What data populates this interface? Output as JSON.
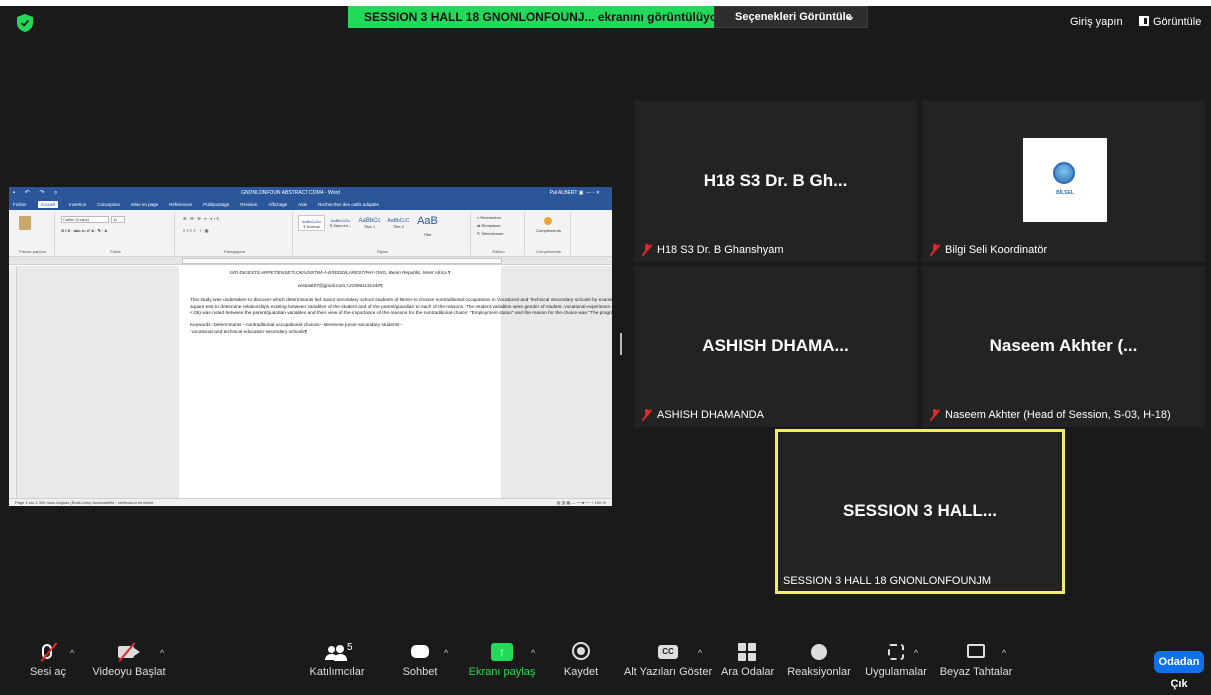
{
  "topbar": {
    "share_banner": "SESSION 3 HALL 18 GNONLONFOUNJ... ekranını görüntülüyorsunuz",
    "options_label": "Seçenekleri Görüntüle",
    "signin_label": "Giriş yapın",
    "view_label": "Görüntüle"
  },
  "shared_doc": {
    "window_title": "GNONLONFOUN ABSTRACT.COM4 - Word",
    "user": "Pal ALBERT",
    "menu": [
      "Fichier",
      "Accueil",
      "Insertion",
      "Conception",
      "Mise en page",
      "Références",
      "Publipostage",
      "Révision",
      "Affichage",
      "Aide",
      "Rechercher des outils adaptés"
    ],
    "ribbon_groups": [
      "Presse-papiers",
      "Police",
      "Paragraphe",
      "Styles",
      "Édition",
      "Compléments"
    ],
    "font_name": "Calibri (Corps)",
    "font_size": "11",
    "styles": [
      "AaBbCcDc",
      "AaBbCcDc",
      "AaBbCc",
      "AaBbCcC",
      "AaB"
    ],
    "style_names": [
      "¶ Normal",
      "¶ Sans int...",
      "Titre 1",
      "Titre 2",
      "Titre"
    ],
    "edit_items": [
      "Rechercher",
      "Remplacer",
      "Sélectionner"
    ],
    "affiliation": "GRI-DIGEST/LARPET/ENSETLOK/UNSTIM-A-EREDD/LAREST/PAY-ONG, Benin Republic, West Africa.¶",
    "email": "vostook07@gmail.com;+229961131340¶",
    "abstract": "This·study·was·undertaken·to·discover·which·determinants·led·Junior·secondary·school·students·of·Benin·to·choose·nontraditional·occupations·in·Vocational·and·Technical·Secondary·schools·by·examining·two·participant·categories:·260·nontraditional·students·enrolled·in·the·26·vocational·and·technical·schools·at·the·rate·of·10·students·per·school,·and·one·of·each·student's·parents.·Two·survey·instruments·were·used·of·which·the·first·15·items·were·questions·directed·to·the·nontraditional·student·or·the·parent/guardian.·The·last·10·items·were·reasons·that·may·have·led·the·student·to·a·nontraditional·choice,·the·importance·of·which·were·determined·by·the·student·and·the·parent/guardian.·Responses·were·subjected·to·a·frequency·distribution·analysis,·and·the·last·10·items·were·subjected·to·the·Chi-square·test·to·determine·relationships·existing·between·variables·of·the·student·and·of·the·parent/guardian·to·each·of·the·reasons.·The·student·variables·were·gender·of·student,·vocational·experience·of·a·student's·sibling/s,·and·participation·in·an·exploratory·program.·The·parent/guardian·variables·were·educational·level,·employment·status,·and·economic·status.·Analyses·of·findings·revealed·that·determinants·such·as·career·opportunity·of·the·program,·interest·in·the·subject,·exploratory·possibilities·and·their·teachers·were·important·to·the·nontraditional·choice.·There·was·only·one·significant·positive·relationship·(p=<.05)·was·noted·between·the·parent/guardian·variables·and·their·view·of·the·importance·of·the·reasons·for·the·nontraditional·choice:·\"Employment·status\"·and·the·reason·for·the·choice·was·\"The·program·seemed·easy.\"·Regardless·of·the·employment·status·of·the·parent,·most·respondents·believed·the·reason·was·not·important·to·the·nontraditional·choice.·Therefore,·exploratory·programs·for·all·the·courses·offered·by·the·VET·secondary·schools·should·be·presented·to·every·new·student·and·that·the·teachers·of·these·exploratory·programs·should·be·chosen·with·great·care.¶",
    "keywords": "Keywords:·Determinants·-·nontraditional·occupational·choices·-·Beninese·junior·secondary·students·-·vocational·and·technical·education·secondary·schools¶",
    "status_left": "Page 1 sur 1    339 mots    Anglais (États-Unis)    Accessibilité : vérification terminée",
    "status_zoom": "100 %"
  },
  "participants": [
    {
      "display": "H18 S3 Dr. B Gh...",
      "name": "H18 S3 Dr. B Ghanshyam",
      "muted": true
    },
    {
      "display": "",
      "name": "Bilgi Seli Koordinatör",
      "muted": true,
      "logo_text": "BİLSEL"
    },
    {
      "display": "ASHISH  DHAMA...",
      "name": "ASHISH DHAMANDA",
      "muted": true
    },
    {
      "display": "Naseem Akhter (...",
      "name": "Naseem Akhter (Head of Session, S-03, H-18)",
      "muted": true
    },
    {
      "display": "SESSION 3 HALL...",
      "name": "SESSION 3 HALL 18 GNONLONFOUNJM",
      "muted": false
    }
  ],
  "toolbar": {
    "audio": "Sesi aç",
    "video": "Videoyu Başlat",
    "participants": "Katılımcılar",
    "participant_count": "5",
    "chat": "Sohbet",
    "share": "Ekranı paylaş",
    "record": "Kaydet",
    "captions": "Alt Yazıları Göster",
    "captions_icon": "CC",
    "breakout": "Ara Odalar",
    "reactions": "Reaksiyonlar",
    "apps": "Uygulamalar",
    "whiteboard": "Beyaz Tahtalar",
    "leave": "Odadan Çık"
  },
  "colors": {
    "share_green": "#23d959",
    "active_speaker": "#f0ec6e",
    "leave_blue": "#0e71eb",
    "muted_red": "#e02828"
  }
}
